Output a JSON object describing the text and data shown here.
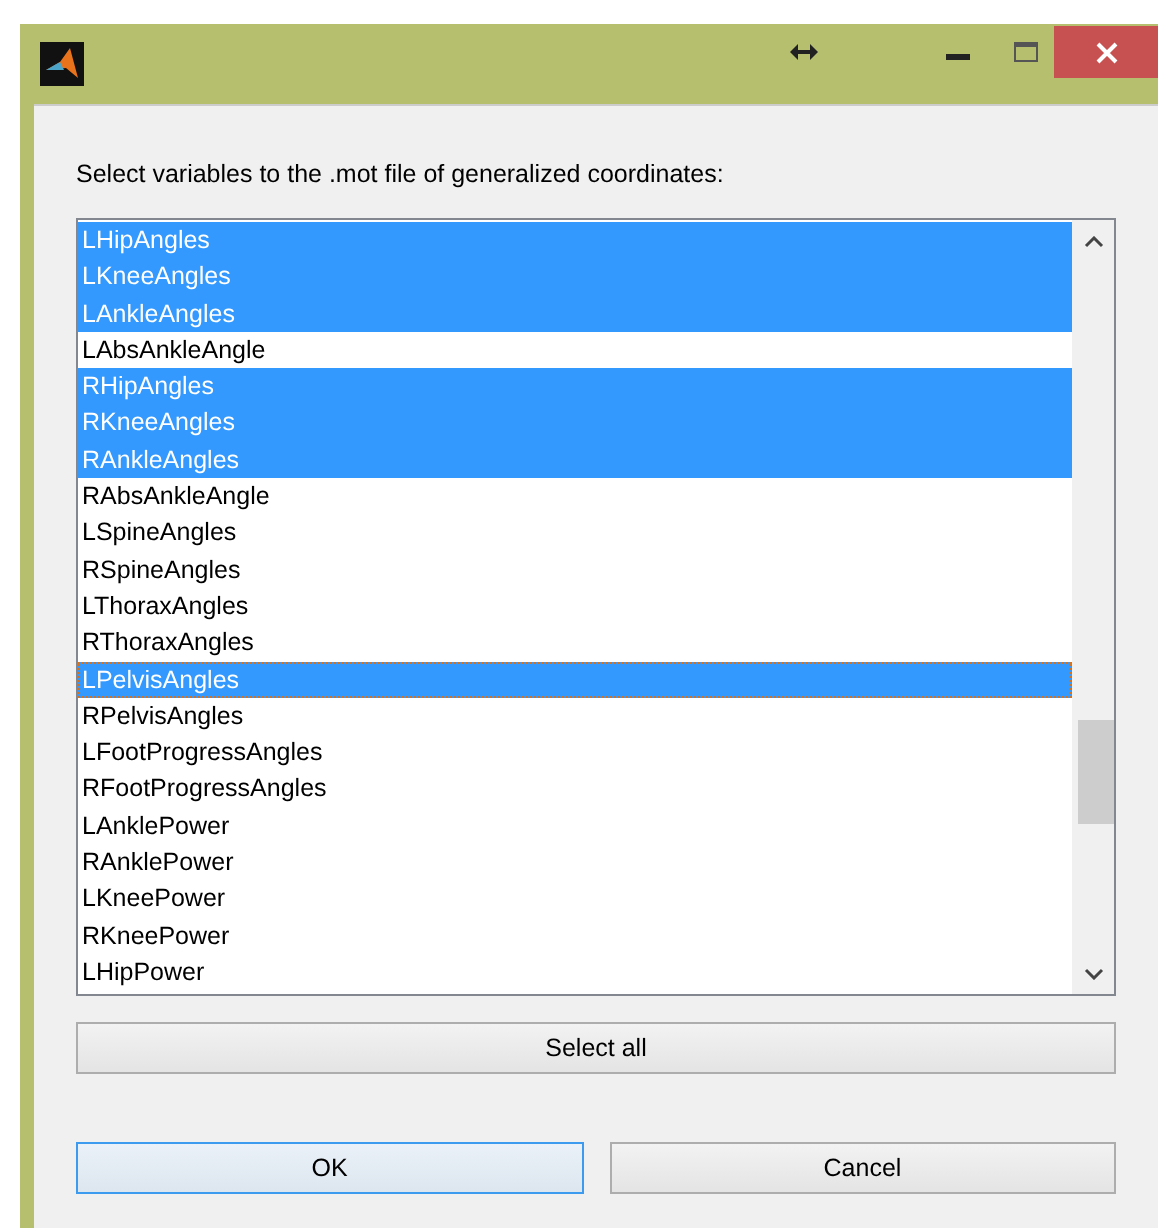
{
  "prompt": "Select variables to the .mot file of generalized coordinates:",
  "variables": [
    {
      "label": "LHipAngles",
      "selected": true,
      "focused": false
    },
    {
      "label": "LKneeAngles",
      "selected": true,
      "focused": false
    },
    {
      "label": "LAnkleAngles",
      "selected": true,
      "focused": false
    },
    {
      "label": "LAbsAnkleAngle",
      "selected": false,
      "focused": false
    },
    {
      "label": "RHipAngles",
      "selected": true,
      "focused": false
    },
    {
      "label": "RKneeAngles",
      "selected": true,
      "focused": false
    },
    {
      "label": "RAnkleAngles",
      "selected": true,
      "focused": false
    },
    {
      "label": "RAbsAnkleAngle",
      "selected": false,
      "focused": false
    },
    {
      "label": "LSpineAngles",
      "selected": false,
      "focused": false
    },
    {
      "label": "RSpineAngles",
      "selected": false,
      "focused": false
    },
    {
      "label": "LThoraxAngles",
      "selected": false,
      "focused": false
    },
    {
      "label": "RThoraxAngles",
      "selected": false,
      "focused": false
    },
    {
      "label": "LPelvisAngles",
      "selected": true,
      "focused": true
    },
    {
      "label": "RPelvisAngles",
      "selected": false,
      "focused": false
    },
    {
      "label": "LFootProgressAngles",
      "selected": false,
      "focused": false
    },
    {
      "label": "RFootProgressAngles",
      "selected": false,
      "focused": false
    },
    {
      "label": "LAnklePower",
      "selected": false,
      "focused": false
    },
    {
      "label": "RAnklePower",
      "selected": false,
      "focused": false
    },
    {
      "label": "LKneePower",
      "selected": false,
      "focused": false
    },
    {
      "label": "RKneePower",
      "selected": false,
      "focused": false
    },
    {
      "label": "LHipPower",
      "selected": false,
      "focused": false
    }
  ],
  "select_all_button": "Select all",
  "buttons": [
    {
      "label": "OK",
      "default": true
    },
    {
      "label": "Cancel",
      "default": false
    }
  ]
}
